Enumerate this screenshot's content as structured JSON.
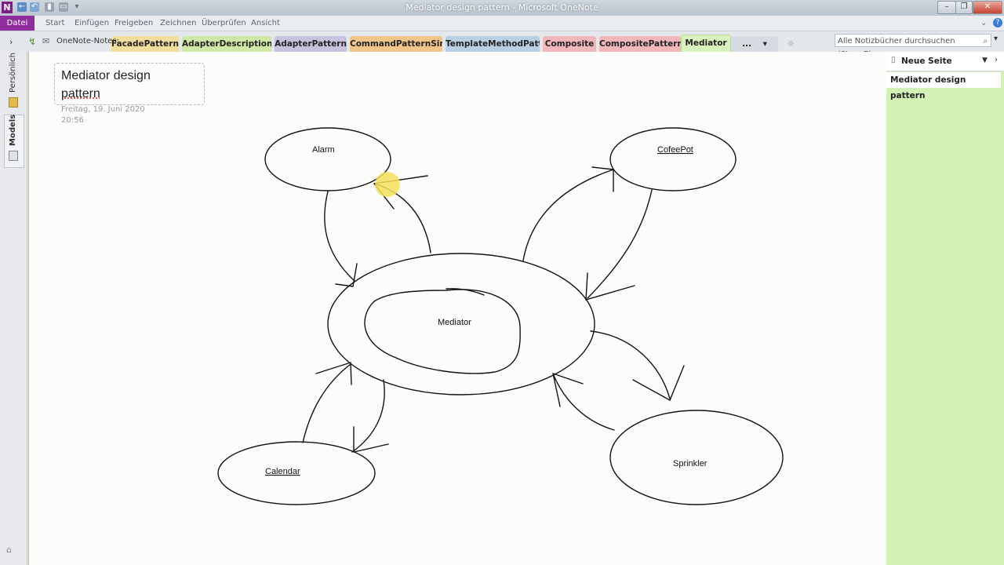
{
  "window": {
    "title": "Mediator design pattern - Microsoft OneNote"
  },
  "menu": {
    "file": "Datei",
    "items": [
      "Start",
      "Einfügen",
      "Freigeben",
      "Zeichnen",
      "Überprüfen",
      "Ansicht"
    ]
  },
  "notebook": {
    "name": "OneNote-Notes:"
  },
  "sections": [
    {
      "label": "FacadePattern",
      "color": "#f3dd9c"
    },
    {
      "label": "AdapterDescription",
      "color": "#cfe8a8"
    },
    {
      "label": "AdapterPattern",
      "color": "#c8c2de"
    },
    {
      "label": "CommandPatternSim...",
      "color": "#f2c58b"
    },
    {
      "label": "TemplateMethodPatt...",
      "color": "#b9d0e4"
    },
    {
      "label": "Composite",
      "color": "#f1b7bb"
    },
    {
      "label": "CompositePattern",
      "color": "#f1b7bb"
    },
    {
      "label": "Mediator",
      "color": "#d8f3be"
    },
    {
      "label": "...",
      "color": "#d6dbe1"
    }
  ],
  "search": {
    "placeholder": "Alle Notizbücher durchsuchen (Strg+E)"
  },
  "left_pane": {
    "personal": "Persönlich",
    "models": "Models"
  },
  "page": {
    "title_line1": "Mediator design",
    "title_line2": "pattern",
    "date": "Freitag, 19. Juni 2020",
    "time": "20:56"
  },
  "diagram": {
    "alarm": "Alarm",
    "coffeepot": "CofeePot",
    "mediator": "Mediator",
    "calendar": "Calendar",
    "sprinkler": "Sprinkler"
  },
  "right_pane": {
    "new_page": "Neue Seite",
    "pages": [
      "Mediator design pattern"
    ]
  },
  "colors": {
    "accent": "#8e2d9b",
    "pages_pane": "#d3f0b6",
    "highlight": "#f5e05a"
  }
}
